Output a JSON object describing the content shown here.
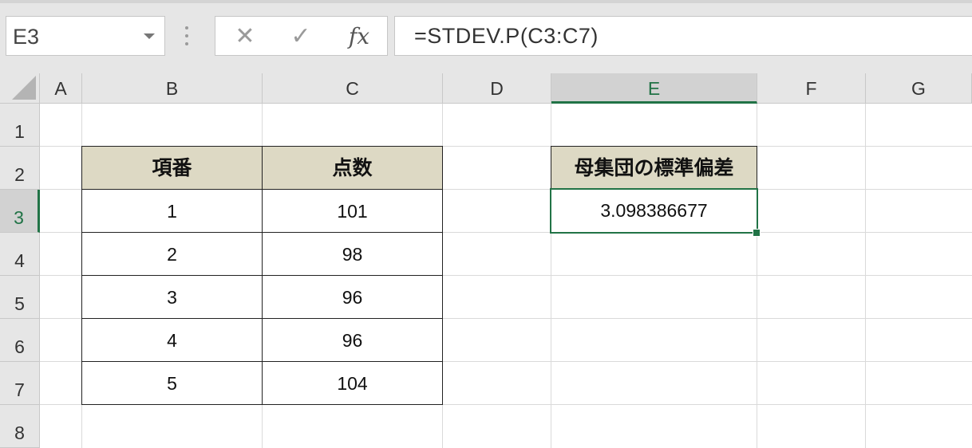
{
  "formula_bar": {
    "name_box": "E3",
    "cancel_icon": "✕",
    "enter_icon": "✓",
    "fx_label": "fx",
    "formula": "=STDEV.P(C3:C7)"
  },
  "columns": [
    "A",
    "B",
    "C",
    "D",
    "E",
    "F",
    "G"
  ],
  "rows": [
    "1",
    "2",
    "3",
    "4",
    "5",
    "6",
    "7",
    "8"
  ],
  "selected_cell": {
    "column": "E",
    "row": "3"
  },
  "table": {
    "headers": [
      "項番",
      "点数"
    ],
    "rows": [
      [
        "1",
        "101"
      ],
      [
        "2",
        "98"
      ],
      [
        "3",
        "96"
      ],
      [
        "4",
        "96"
      ],
      [
        "5",
        "104"
      ]
    ]
  },
  "result": {
    "header": "母集団の標準偏差",
    "value": "3.098386677"
  },
  "colors": {
    "header_fill": "#ddd9c4",
    "selection_green": "#217346"
  }
}
